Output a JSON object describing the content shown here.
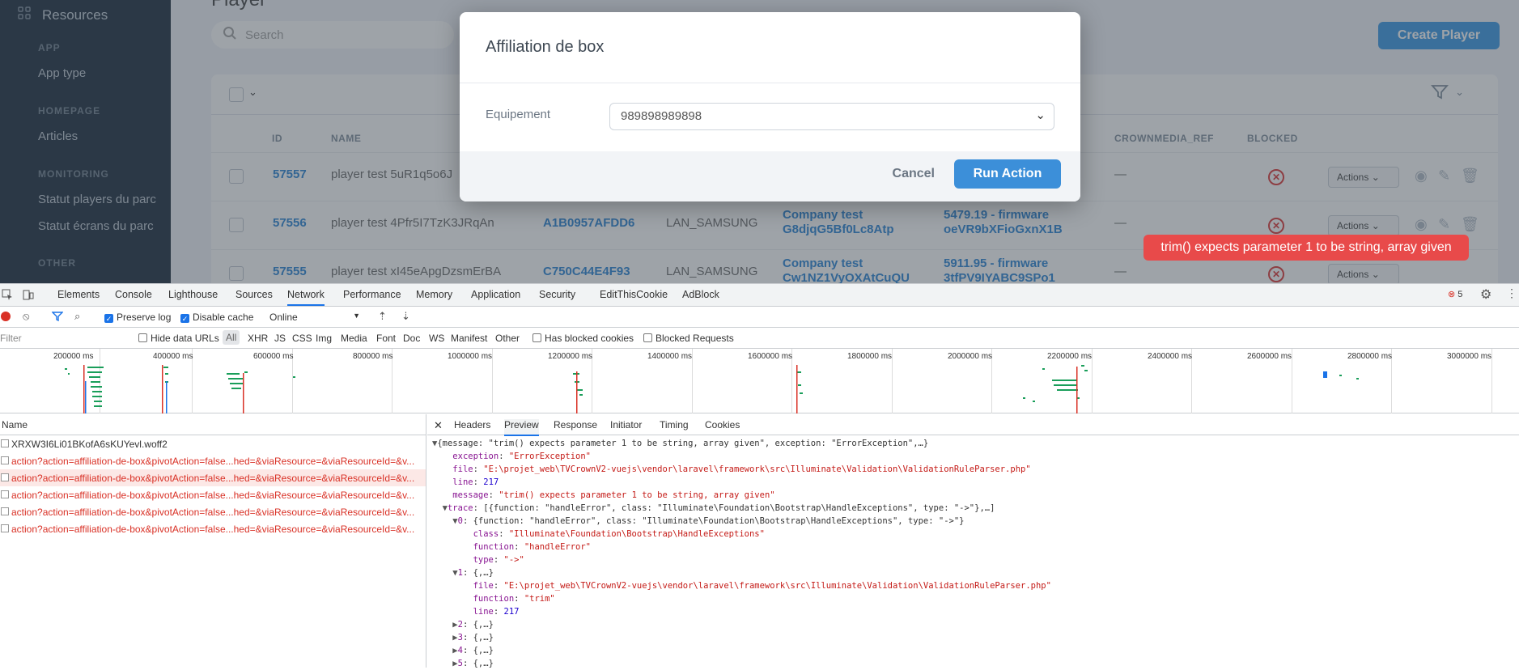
{
  "sidebar": {
    "resources": "Resources",
    "sections": [
      {
        "label": "APP",
        "items": [
          "App type"
        ]
      },
      {
        "label": "HOMEPAGE",
        "items": [
          "Articles"
        ]
      },
      {
        "label": "MONITORING",
        "items": [
          "Statut players du parc",
          "Statut écrans du parc"
        ]
      },
      {
        "label": "OTHER",
        "items": []
      }
    ]
  },
  "page": {
    "title": "Player",
    "search_placeholder": "Search",
    "create_label": "Create Player",
    "columns": {
      "id": "ID",
      "name": "NAME",
      "crownmedia_ref": "CROWNMEDIA_REF",
      "blocked": "BLOCKED"
    },
    "rows": [
      {
        "id": "57557",
        "name": "player test 5uR1q5o6J",
        "ref": "",
        "type": "",
        "company": [
          "",
          ""
        ],
        "firmware": [
          "",
          ""
        ],
        "crown": "—",
        "actions": "Actions"
      },
      {
        "id": "57556",
        "name": "player test 4Pfr5I7TzK3JRqAn",
        "ref": "A1B0957AFDD6",
        "type": "LAN_SAMSUNG",
        "company": [
          "Company test",
          "G8djqG5Bf0Lc8Atp"
        ],
        "firmware": [
          "5479.19 - firmware",
          "oeVR9bXFioGxnX1B"
        ],
        "crown": "—",
        "actions": "Actions"
      },
      {
        "id": "57555",
        "name": "player test xI45eApgDzsmErBA",
        "ref": "C750C44E4F93",
        "type": "LAN_SAMSUNG",
        "company": [
          "Company test",
          "Cw1NZ1VyOXAtCuQU"
        ],
        "firmware": [
          "5911.95 - firmware",
          "3tfPV9IYABC9SPo1"
        ],
        "crown": "—",
        "actions": "Actions"
      }
    ]
  },
  "modal": {
    "title": "Affiliation de box",
    "field_label": "Equipement",
    "field_value": "989898989898",
    "cancel": "Cancel",
    "run": "Run Action"
  },
  "toast": "trim() expects parameter 1 to be string, array given",
  "devtools": {
    "tabs": [
      "Elements",
      "Console",
      "Lighthouse",
      "Sources",
      "Network",
      "Performance",
      "Memory",
      "Application",
      "Security",
      "EditThisCookie",
      "AdBlock"
    ],
    "error_count": "5",
    "preserve_log": "Preserve log",
    "disable_cache": "Disable cache",
    "throttle": "Online",
    "filter_placeholder": "Filter",
    "hide_data_urls": "Hide data URLs",
    "types": [
      "All",
      "XHR",
      "JS",
      "CSS",
      "Img",
      "Media",
      "Font",
      "Doc",
      "WS",
      "Manifest",
      "Other"
    ],
    "has_blocked_cookies": "Has blocked cookies",
    "blocked_requests": "Blocked Requests",
    "timeline_ticks": [
      "200000 ms",
      "400000 ms",
      "600000 ms",
      "800000 ms",
      "1000000 ms",
      "1200000 ms",
      "1400000 ms",
      "1600000 ms",
      "1800000 ms",
      "2000000 ms",
      "2200000 ms",
      "2400000 ms",
      "2600000 ms",
      "2800000 ms",
      "3000000 ms"
    ],
    "name_header": "Name",
    "requests": [
      "XRXW3I6Li01BKofA6sKUYevl.woff2",
      "action?action=affiliation-de-box&pivotAction=false...hed=&viaResource=&viaResourceId=&v...",
      "action?action=affiliation-de-box&pivotAction=false...hed=&viaResource=&viaResourceId=&v...",
      "action?action=affiliation-de-box&pivotAction=false...hed=&viaResource=&viaResourceId=&v...",
      "action?action=affiliation-de-box&pivotAction=false...hed=&viaResource=&viaResourceId=&v...",
      "action?action=affiliation-de-box&pivotAction=false...hed=&viaResource=&viaResourceId=&v..."
    ],
    "detail_tabs": [
      "Headers",
      "Preview",
      "Response",
      "Initiator",
      "Timing",
      "Cookies"
    ],
    "preview": {
      "summary": "{message: \"trim() expects parameter 1 to be string, array given\", exception: \"ErrorException\",…}",
      "exception": "\"ErrorException\"",
      "file": "\"E:\\projet_web\\TVCrownV2-vuejs\\vendor\\laravel\\framework\\src\\Illuminate\\Validation\\ValidationRuleParser.php\"",
      "line": "217",
      "message": "\"trim() expects parameter 1 to be string, array given\"",
      "trace_summary": "[{function: \"handleError\", class: \"Illuminate\\Foundation\\Bootstrap\\HandleExceptions\", type: \"->\"},…]",
      "t0_summary": "{function: \"handleError\", class: \"Illuminate\\Foundation\\Bootstrap\\HandleExceptions\", type: \"->\"}",
      "t0_class": "\"Illuminate\\Foundation\\Bootstrap\\HandleExceptions\"",
      "t0_function": "\"handleError\"",
      "t0_type": "\"->\"",
      "t1_summary": "{,…}",
      "t1_file": "\"E:\\projet_web\\TVCrownV2-vuejs\\vendor\\laravel\\framework\\src\\Illuminate\\Validation\\ValidationRuleParser.php\"",
      "t1_function": "\"trim\"",
      "t1_line": "217",
      "t2": "{,…}",
      "t3": "{,…}",
      "t4": "{,…}",
      "t5": "{,…}"
    }
  }
}
